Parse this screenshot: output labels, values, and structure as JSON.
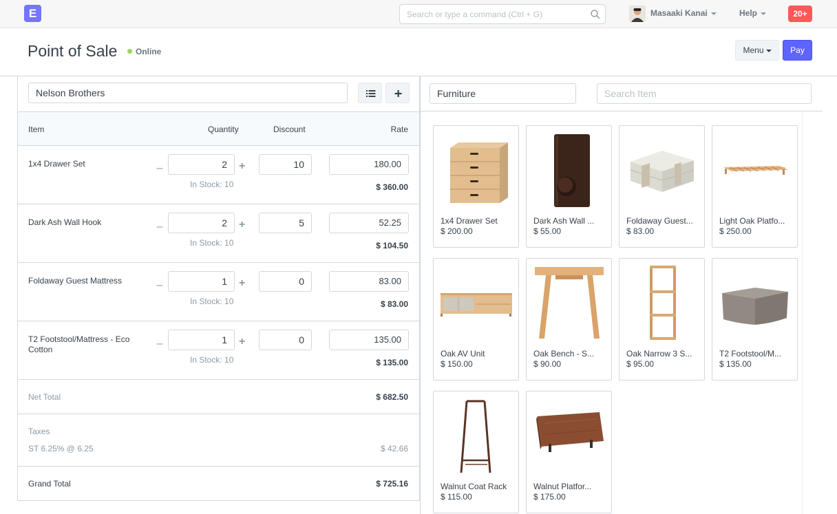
{
  "navbar": {
    "logo_letter": "E",
    "search_placeholder": "Search or type a command (Ctrl + G)",
    "user_name": "Masaaki Kanai",
    "help_label": "Help",
    "notification_count": "20+"
  },
  "page": {
    "title": "Point of Sale",
    "status": "Online",
    "menu_label": "Menu",
    "pay_label": "Pay"
  },
  "cart": {
    "customer": "Nelson Brothers",
    "headers": {
      "item": "Item",
      "quantity": "Quantity",
      "discount": "Discount",
      "rate": "Rate"
    },
    "rows": [
      {
        "name": "1x4 Drawer Set",
        "qty": "2",
        "discount": "10",
        "rate": "180.00",
        "stock": "In Stock: 10",
        "amount": "$ 360.00"
      },
      {
        "name": "Dark Ash Wall Hook",
        "qty": "2",
        "discount": "5",
        "rate": "52.25",
        "stock": "In Stock: 10",
        "amount": "$ 104.50"
      },
      {
        "name": "Foldaway Guest Mattress",
        "qty": "1",
        "discount": "0",
        "rate": "83.00",
        "stock": "In Stock: 10",
        "amount": "$ 83.00"
      },
      {
        "name": "T2 Footstool/Mattress - Eco Cotton",
        "qty": "1",
        "discount": "0",
        "rate": "135.00",
        "stock": "In Stock: 10",
        "amount": "$ 135.00"
      }
    ],
    "net_total_label": "Net Total",
    "net_total": "$ 682.50",
    "taxes_label": "Taxes",
    "tax_name": "ST 6.25% @ 6.25",
    "tax_amount": "$ 42.66",
    "grand_total_label": "Grand Total",
    "grand_total": "$ 725.16"
  },
  "items": {
    "item_group": "Furniture",
    "search_placeholder": "Search Item",
    "list": [
      {
        "name": "1x4 Drawer Set",
        "price": "$ 200.00"
      },
      {
        "name": "Dark Ash Wall ...",
        "price": "$ 55.00"
      },
      {
        "name": "Foldaway Guest...",
        "price": "$ 83.00"
      },
      {
        "name": "Light Oak Platfo...",
        "price": "$ 250.00"
      },
      {
        "name": "Oak AV Unit",
        "price": "$ 150.00"
      },
      {
        "name": "Oak Bench - S...",
        "price": "$ 90.00"
      },
      {
        "name": "Oak Narrow 3 S...",
        "price": "$ 95.00"
      },
      {
        "name": "T2 Footstool/M...",
        "price": "$ 135.00"
      },
      {
        "name": "Walnut Coat Rack",
        "price": "$ 115.00"
      },
      {
        "name": "Walnut Platfor...",
        "price": "$ 175.00"
      }
    ]
  }
}
